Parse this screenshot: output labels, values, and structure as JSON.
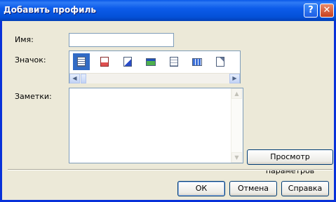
{
  "window": {
    "title": "Добавить профиль",
    "help_glyph": "?",
    "close_glyph": "✕"
  },
  "form": {
    "name_label": "Имя:",
    "name_value": "",
    "icon_label": "Значок:",
    "notes_label": "Заметки:",
    "notes_value": ""
  },
  "icons": [
    {
      "name": "document-lines-icon",
      "selected": true
    },
    {
      "name": "document-red-icon",
      "selected": false
    },
    {
      "name": "document-arrow-icon",
      "selected": false
    },
    {
      "name": "window-green-icon",
      "selected": false
    },
    {
      "name": "document-plain-icon",
      "selected": false
    },
    {
      "name": "grid-icon",
      "selected": false
    },
    {
      "name": "document-fold-icon",
      "selected": false
    }
  ],
  "buttons": {
    "preview": "Просмотр параметров",
    "ok": "ОК",
    "cancel": "Отмена",
    "help": "Справка"
  },
  "colors": {
    "titlebar": "#0451D8",
    "selection": "#316AC5",
    "dialog_bg": "#ECE9D8"
  }
}
